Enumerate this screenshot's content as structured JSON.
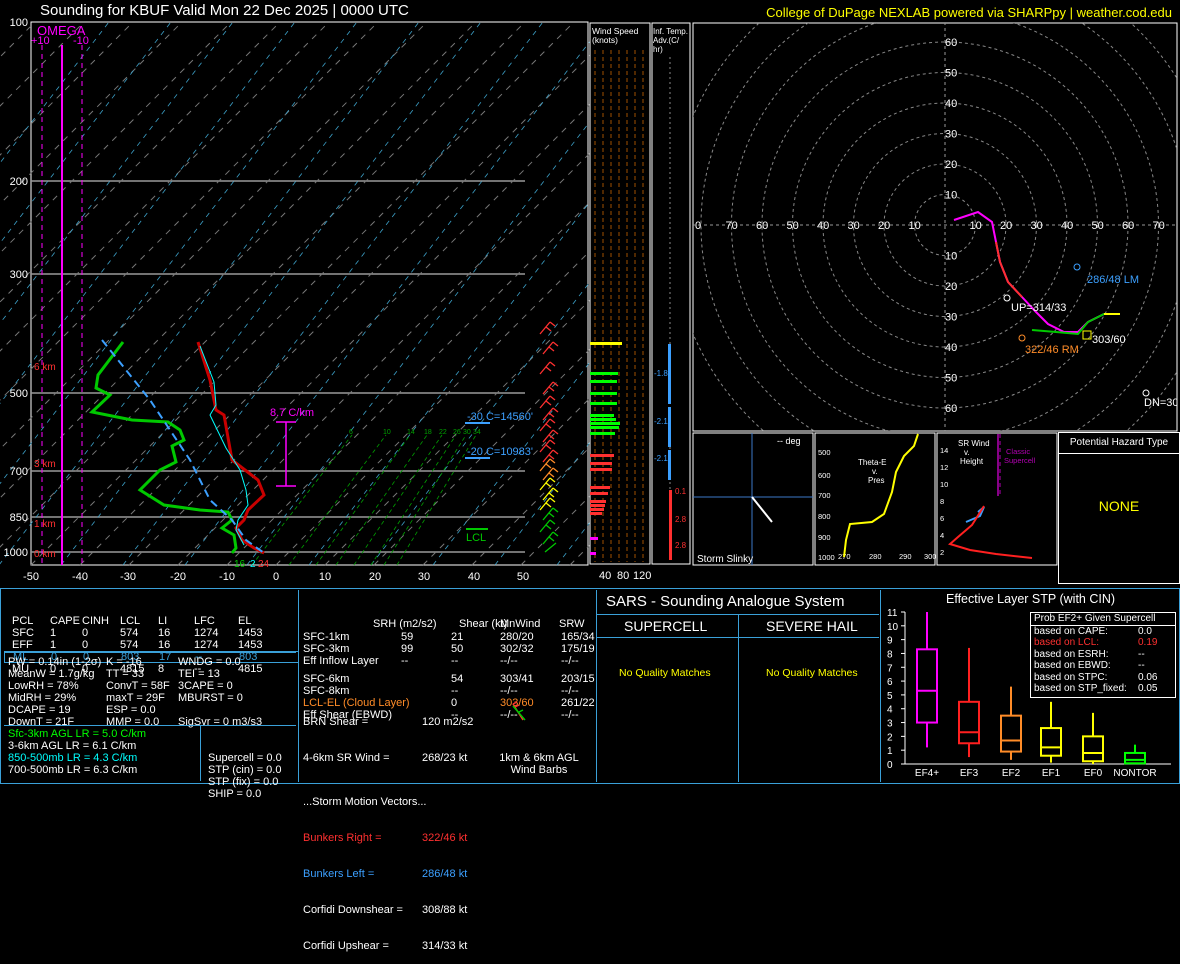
{
  "header": {
    "title": "Sounding for KBUF Valid  Mon 22 Dec 2025 | 0000 UTC",
    "credit": "College of DuPage NEXLAB powered via SHARPpy | weather.cod.edu"
  },
  "skewt": {
    "pressure_labels": [
      "100",
      "200",
      "300",
      "500",
      "700",
      "850",
      "1000"
    ],
    "temp_labels": [
      "-50",
      "-40",
      "-30",
      "-20",
      "-10",
      "0",
      "10",
      "20",
      "30",
      "40",
      "50"
    ],
    "omega": {
      "title": "OMEGA",
      "left": "+10",
      "right": "-10"
    },
    "heights": [
      "6 km",
      "3 km",
      "1 km",
      "0 km"
    ],
    "lapse_label": "8.7 C/km",
    "wetbulb_labels": [
      "-30 C=14560'",
      "-20 C=10983'"
    ],
    "lcl": "LCL",
    "sfc_vals": {
      "td": "16",
      "tw": "2",
      "t": "24"
    },
    "mixing_ratios": [
      "6",
      "10",
      "14",
      "18",
      "22",
      "26",
      "30",
      "34"
    ]
  },
  "wind_speed": {
    "title": "Wind Speed (knots)",
    "ticks": [
      "40",
      "80",
      "120"
    ]
  },
  "inf_temp": {
    "title": "Inf. Temp. Adv.(C/hr)",
    "values": [
      "-1.8",
      "-2.1",
      "-2.1",
      "0.1",
      "2.8",
      "2.8"
    ]
  },
  "hodograph": {
    "rings": [
      "10",
      "20",
      "30",
      "40",
      "50",
      "60",
      "70"
    ],
    "upper_labels": [
      "60",
      "50",
      "40",
      "30",
      "20",
      "10"
    ],
    "lower_labels": [
      "10",
      "20",
      "30",
      "40",
      "50",
      "60"
    ],
    "lm": "286/48 LM",
    "up": "UP=314/33",
    "rm": "322/46 RM",
    "mean": "303/60",
    "dn": "DN=308/88"
  },
  "storm_slinky": {
    "deg": "-- deg",
    "label": "Storm Slinky"
  },
  "theta": {
    "title": "Theta-E v. Pres",
    "x": [
      "270",
      "280",
      "290",
      "300"
    ],
    "y": [
      "500",
      "600",
      "700",
      "800",
      "900",
      "1000"
    ]
  },
  "srwind": {
    "title": "SR Wind v. Height",
    "classic": "Classic Supercell",
    "y": [
      "14",
      "12",
      "10",
      "8",
      "6",
      "4",
      "2"
    ]
  },
  "hazard": {
    "title": "Potential Hazard Type",
    "value": "NONE"
  },
  "parcels": {
    "headers": [
      "PCL",
      "CAPE",
      "CINH",
      "LCL",
      "LI",
      "LFC",
      "EL"
    ],
    "rows": [
      [
        "SFC",
        "1",
        "0",
        "574",
        "16",
        "1274",
        "1453"
      ],
      [
        "EFF",
        "1",
        "0",
        "574",
        "16",
        "1274",
        "1453"
      ],
      [
        "ML",
        "0",
        "0",
        "803",
        "17",
        "--",
        "803"
      ],
      [
        "MU",
        "0",
        "0",
        "4815",
        "8",
        "--",
        "4815"
      ]
    ]
  },
  "indices": [
    [
      "PW = 0.14in (1-2σ)",
      "K = -16",
      "WNDG = 0.0"
    ],
    [
      "MeanW = 1.7g/kg",
      "TT = 33",
      "TEI = 13"
    ],
    [
      "LowRH = 78%",
      "ConvT = 58F",
      "3CAPE = 0"
    ],
    [
      "MidRH = 29%",
      "maxT = 29F",
      "MBURST = 0"
    ],
    [
      "DCAPE = 19",
      "ESP = 0.0",
      ""
    ],
    [
      "DownT = 21F",
      "MMP = 0.0",
      "SigSvr = 0 m3/s3"
    ]
  ],
  "lapse": [
    {
      "text": "Sfc-3km AGL LR = 5.0 C/km",
      "color": "#00ff00"
    },
    {
      "text": "3-6km AGL LR = 6.1 C/km",
      "color": "#ffffff"
    },
    {
      "text": "850-500mb LR = 4.3 C/km",
      "color": "#00ffff"
    },
    {
      "text": "700-500mb LR = 6.3 C/km",
      "color": "#ffffff"
    }
  ],
  "composite": [
    "Supercell = 0.0",
    "STP (cin) = 0.0",
    "STP (fix) = 0.0",
    "SHIP = 0.0"
  ],
  "kinematics": {
    "headers": [
      "SRH (m2/s2)",
      "Shear (kt)",
      "MnWind",
      "SRW"
    ],
    "rows": [
      [
        "SFC-1km",
        "59",
        "21",
        "280/20",
        "165/34"
      ],
      [
        "SFC-3km",
        "99",
        "50",
        "302/32",
        "175/19"
      ],
      [
        "Eff Inflow Layer",
        "--",
        "--",
        "--/--",
        "--/--"
      ],
      [
        "",
        "",
        " ",
        "",
        ""
      ],
      [
        "SFC-6km",
        "",
        "54",
        "303/41",
        "203/15"
      ],
      [
        "SFC-8km",
        "",
        "--",
        "--/--",
        "--/--"
      ],
      [
        "LCL-EL (Cloud Layer)",
        "",
        "0",
        "303/60",
        "261/22"
      ],
      [
        "Eff Shear (EBWD)",
        "",
        "--",
        "--/--",
        "--/--"
      ]
    ],
    "brn_shear": "BRN Shear =",
    "brn_val": "120 m2/s2",
    "sr_wind": "4-6km SR Wind =",
    "sr_val": "268/23 kt",
    "storm_title": "...Storm Motion Vectors...",
    "bunkers_right": "Bunkers Right =",
    "br_val": "322/46 kt",
    "bunkers_left": "Bunkers Left =",
    "bl_val": "286/48 kt",
    "corfidi_down": "Corfidi Downshear =",
    "cd_val": "308/88 kt",
    "corfidi_up": "Corfidi Upshear =",
    "cu_val": "314/33 kt",
    "barbs": "1km & 6km AGL Wind Barbs"
  },
  "sars": {
    "title": "SARS - Sounding Analogue System",
    "supercell": "SUPERCELL",
    "hail": "SEVERE HAIL",
    "no1": "No Quality Matches",
    "no2": "No Quality Matches"
  },
  "stp": {
    "title": "Effective Layer STP (with CIN)",
    "prob_title": "Prob EF2+ Given Supercell",
    "probs": [
      [
        "based on CAPE:",
        "0.0",
        "#ffffff"
      ],
      [
        "based on LCL:",
        "0.19",
        "#ff3030"
      ],
      [
        "based on ESRH:",
        "--",
        "#ffffff"
      ],
      [
        "based on EBWD:",
        "--",
        "#ffffff"
      ],
      [
        "based on STPC:",
        "0.06",
        "#ffffff"
      ],
      [
        "based on STP_fixed:",
        "0.05",
        "#ffffff"
      ]
    ],
    "y_ticks": [
      "0",
      "1",
      "2",
      "3",
      "4",
      "5",
      "6",
      "7",
      "8",
      "9",
      "10",
      "11"
    ]
  },
  "chart_data": {
    "type": "box",
    "title": "Effective Layer STP (with CIN)",
    "categories": [
      "EF4+",
      "EF3",
      "EF2",
      "EF1",
      "EF0",
      "NONTOR"
    ],
    "colors": [
      "#ff00ff",
      "#ff2020",
      "#ff8c28",
      "#ffff00",
      "#ffff00",
      "#00ff00"
    ],
    "boxes": [
      {
        "lo": 1.2,
        "q1": 3.0,
        "med": 5.3,
        "q3": 8.3,
        "hi": 11.0
      },
      {
        "lo": 0.5,
        "q1": 1.5,
        "med": 2.3,
        "q3": 4.5,
        "hi": 8.4
      },
      {
        "lo": 0.3,
        "q1": 0.9,
        "med": 1.7,
        "q3": 3.5,
        "hi": 5.6
      },
      {
        "lo": 0.1,
        "q1": 0.6,
        "med": 1.2,
        "q3": 2.6,
        "hi": 4.5
      },
      {
        "lo": 0.0,
        "q1": 0.2,
        "med": 0.8,
        "q3": 2.0,
        "hi": 3.7
      },
      {
        "lo": 0.0,
        "q1": 0.05,
        "med": 0.3,
        "q3": 0.8,
        "hi": 1.4
      }
    ],
    "ylim": [
      0,
      11
    ]
  }
}
